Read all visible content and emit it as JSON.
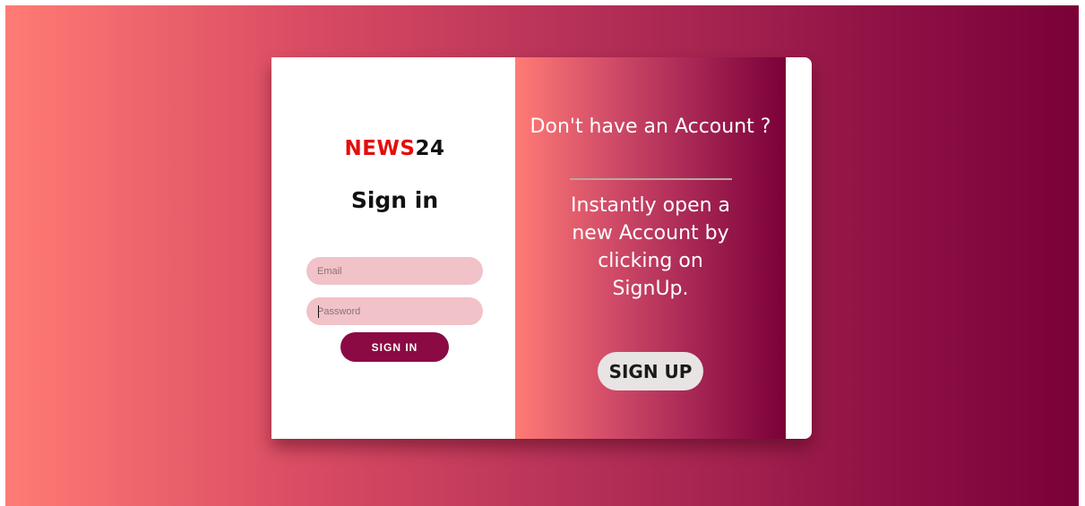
{
  "brand": {
    "part1": "NEWS",
    "part2": "24",
    "color_primary": "#e40d0d",
    "color_secondary": "#111111"
  },
  "signin": {
    "title": "Sign in",
    "email_placeholder": "Email",
    "password_placeholder": "Password",
    "button_label": "SIGN IN",
    "button_color": "#8b0a43",
    "input_color": "#f1c2c8"
  },
  "signup_panel": {
    "heading": "Don't have an Account ?",
    "body": "Instantly open a new Account by clicking on SignUp.",
    "button_label": "SIGN UP"
  },
  "theme": {
    "gradient_start": "#ff7b74",
    "gradient_end": "#7a0038"
  }
}
